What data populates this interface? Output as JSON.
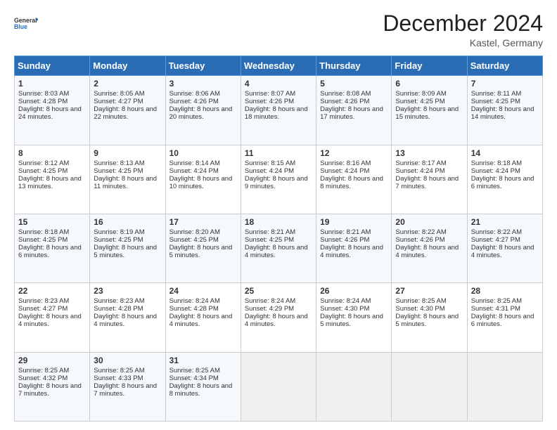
{
  "header": {
    "logo_line1": "General",
    "logo_line2": "Blue",
    "month": "December 2024",
    "location": "Kastel, Germany"
  },
  "days_of_week": [
    "Sunday",
    "Monday",
    "Tuesday",
    "Wednesday",
    "Thursday",
    "Friday",
    "Saturday"
  ],
  "weeks": [
    [
      {
        "day": 1,
        "sunrise": "8:03 AM",
        "sunset": "4:28 PM",
        "daylight": "8 hours and 24 minutes"
      },
      {
        "day": 2,
        "sunrise": "8:05 AM",
        "sunset": "4:27 PM",
        "daylight": "8 hours and 22 minutes"
      },
      {
        "day": 3,
        "sunrise": "8:06 AM",
        "sunset": "4:26 PM",
        "daylight": "8 hours and 20 minutes"
      },
      {
        "day": 4,
        "sunrise": "8:07 AM",
        "sunset": "4:26 PM",
        "daylight": "8 hours and 18 minutes"
      },
      {
        "day": 5,
        "sunrise": "8:08 AM",
        "sunset": "4:26 PM",
        "daylight": "8 hours and 17 minutes"
      },
      {
        "day": 6,
        "sunrise": "8:09 AM",
        "sunset": "4:25 PM",
        "daylight": "8 hours and 15 minutes"
      },
      {
        "day": 7,
        "sunrise": "8:11 AM",
        "sunset": "4:25 PM",
        "daylight": "8 hours and 14 minutes"
      }
    ],
    [
      {
        "day": 8,
        "sunrise": "8:12 AM",
        "sunset": "4:25 PM",
        "daylight": "8 hours and 13 minutes"
      },
      {
        "day": 9,
        "sunrise": "8:13 AM",
        "sunset": "4:25 PM",
        "daylight": "8 hours and 11 minutes"
      },
      {
        "day": 10,
        "sunrise": "8:14 AM",
        "sunset": "4:24 PM",
        "daylight": "8 hours and 10 minutes"
      },
      {
        "day": 11,
        "sunrise": "8:15 AM",
        "sunset": "4:24 PM",
        "daylight": "8 hours and 9 minutes"
      },
      {
        "day": 12,
        "sunrise": "8:16 AM",
        "sunset": "4:24 PM",
        "daylight": "8 hours and 8 minutes"
      },
      {
        "day": 13,
        "sunrise": "8:17 AM",
        "sunset": "4:24 PM",
        "daylight": "8 hours and 7 minutes"
      },
      {
        "day": 14,
        "sunrise": "8:18 AM",
        "sunset": "4:24 PM",
        "daylight": "8 hours and 6 minutes"
      }
    ],
    [
      {
        "day": 15,
        "sunrise": "8:18 AM",
        "sunset": "4:25 PM",
        "daylight": "8 hours and 6 minutes"
      },
      {
        "day": 16,
        "sunrise": "8:19 AM",
        "sunset": "4:25 PM",
        "daylight": "8 hours and 5 minutes"
      },
      {
        "day": 17,
        "sunrise": "8:20 AM",
        "sunset": "4:25 PM",
        "daylight": "8 hours and 5 minutes"
      },
      {
        "day": 18,
        "sunrise": "8:21 AM",
        "sunset": "4:25 PM",
        "daylight": "8 hours and 4 minutes"
      },
      {
        "day": 19,
        "sunrise": "8:21 AM",
        "sunset": "4:26 PM",
        "daylight": "8 hours and 4 minutes"
      },
      {
        "day": 20,
        "sunrise": "8:22 AM",
        "sunset": "4:26 PM",
        "daylight": "8 hours and 4 minutes"
      },
      {
        "day": 21,
        "sunrise": "8:22 AM",
        "sunset": "4:27 PM",
        "daylight": "8 hours and 4 minutes"
      }
    ],
    [
      {
        "day": 22,
        "sunrise": "8:23 AM",
        "sunset": "4:27 PM",
        "daylight": "8 hours and 4 minutes"
      },
      {
        "day": 23,
        "sunrise": "8:23 AM",
        "sunset": "4:28 PM",
        "daylight": "8 hours and 4 minutes"
      },
      {
        "day": 24,
        "sunrise": "8:24 AM",
        "sunset": "4:28 PM",
        "daylight": "8 hours and 4 minutes"
      },
      {
        "day": 25,
        "sunrise": "8:24 AM",
        "sunset": "4:29 PM",
        "daylight": "8 hours and 4 minutes"
      },
      {
        "day": 26,
        "sunrise": "8:24 AM",
        "sunset": "4:30 PM",
        "daylight": "8 hours and 5 minutes"
      },
      {
        "day": 27,
        "sunrise": "8:25 AM",
        "sunset": "4:30 PM",
        "daylight": "8 hours and 5 minutes"
      },
      {
        "day": 28,
        "sunrise": "8:25 AM",
        "sunset": "4:31 PM",
        "daylight": "8 hours and 6 minutes"
      }
    ],
    [
      {
        "day": 29,
        "sunrise": "8:25 AM",
        "sunset": "4:32 PM",
        "daylight": "8 hours and 7 minutes"
      },
      {
        "day": 30,
        "sunrise": "8:25 AM",
        "sunset": "4:33 PM",
        "daylight": "8 hours and 7 minutes"
      },
      {
        "day": 31,
        "sunrise": "8:25 AM",
        "sunset": "4:34 PM",
        "daylight": "8 hours and 8 minutes"
      },
      null,
      null,
      null,
      null
    ]
  ]
}
